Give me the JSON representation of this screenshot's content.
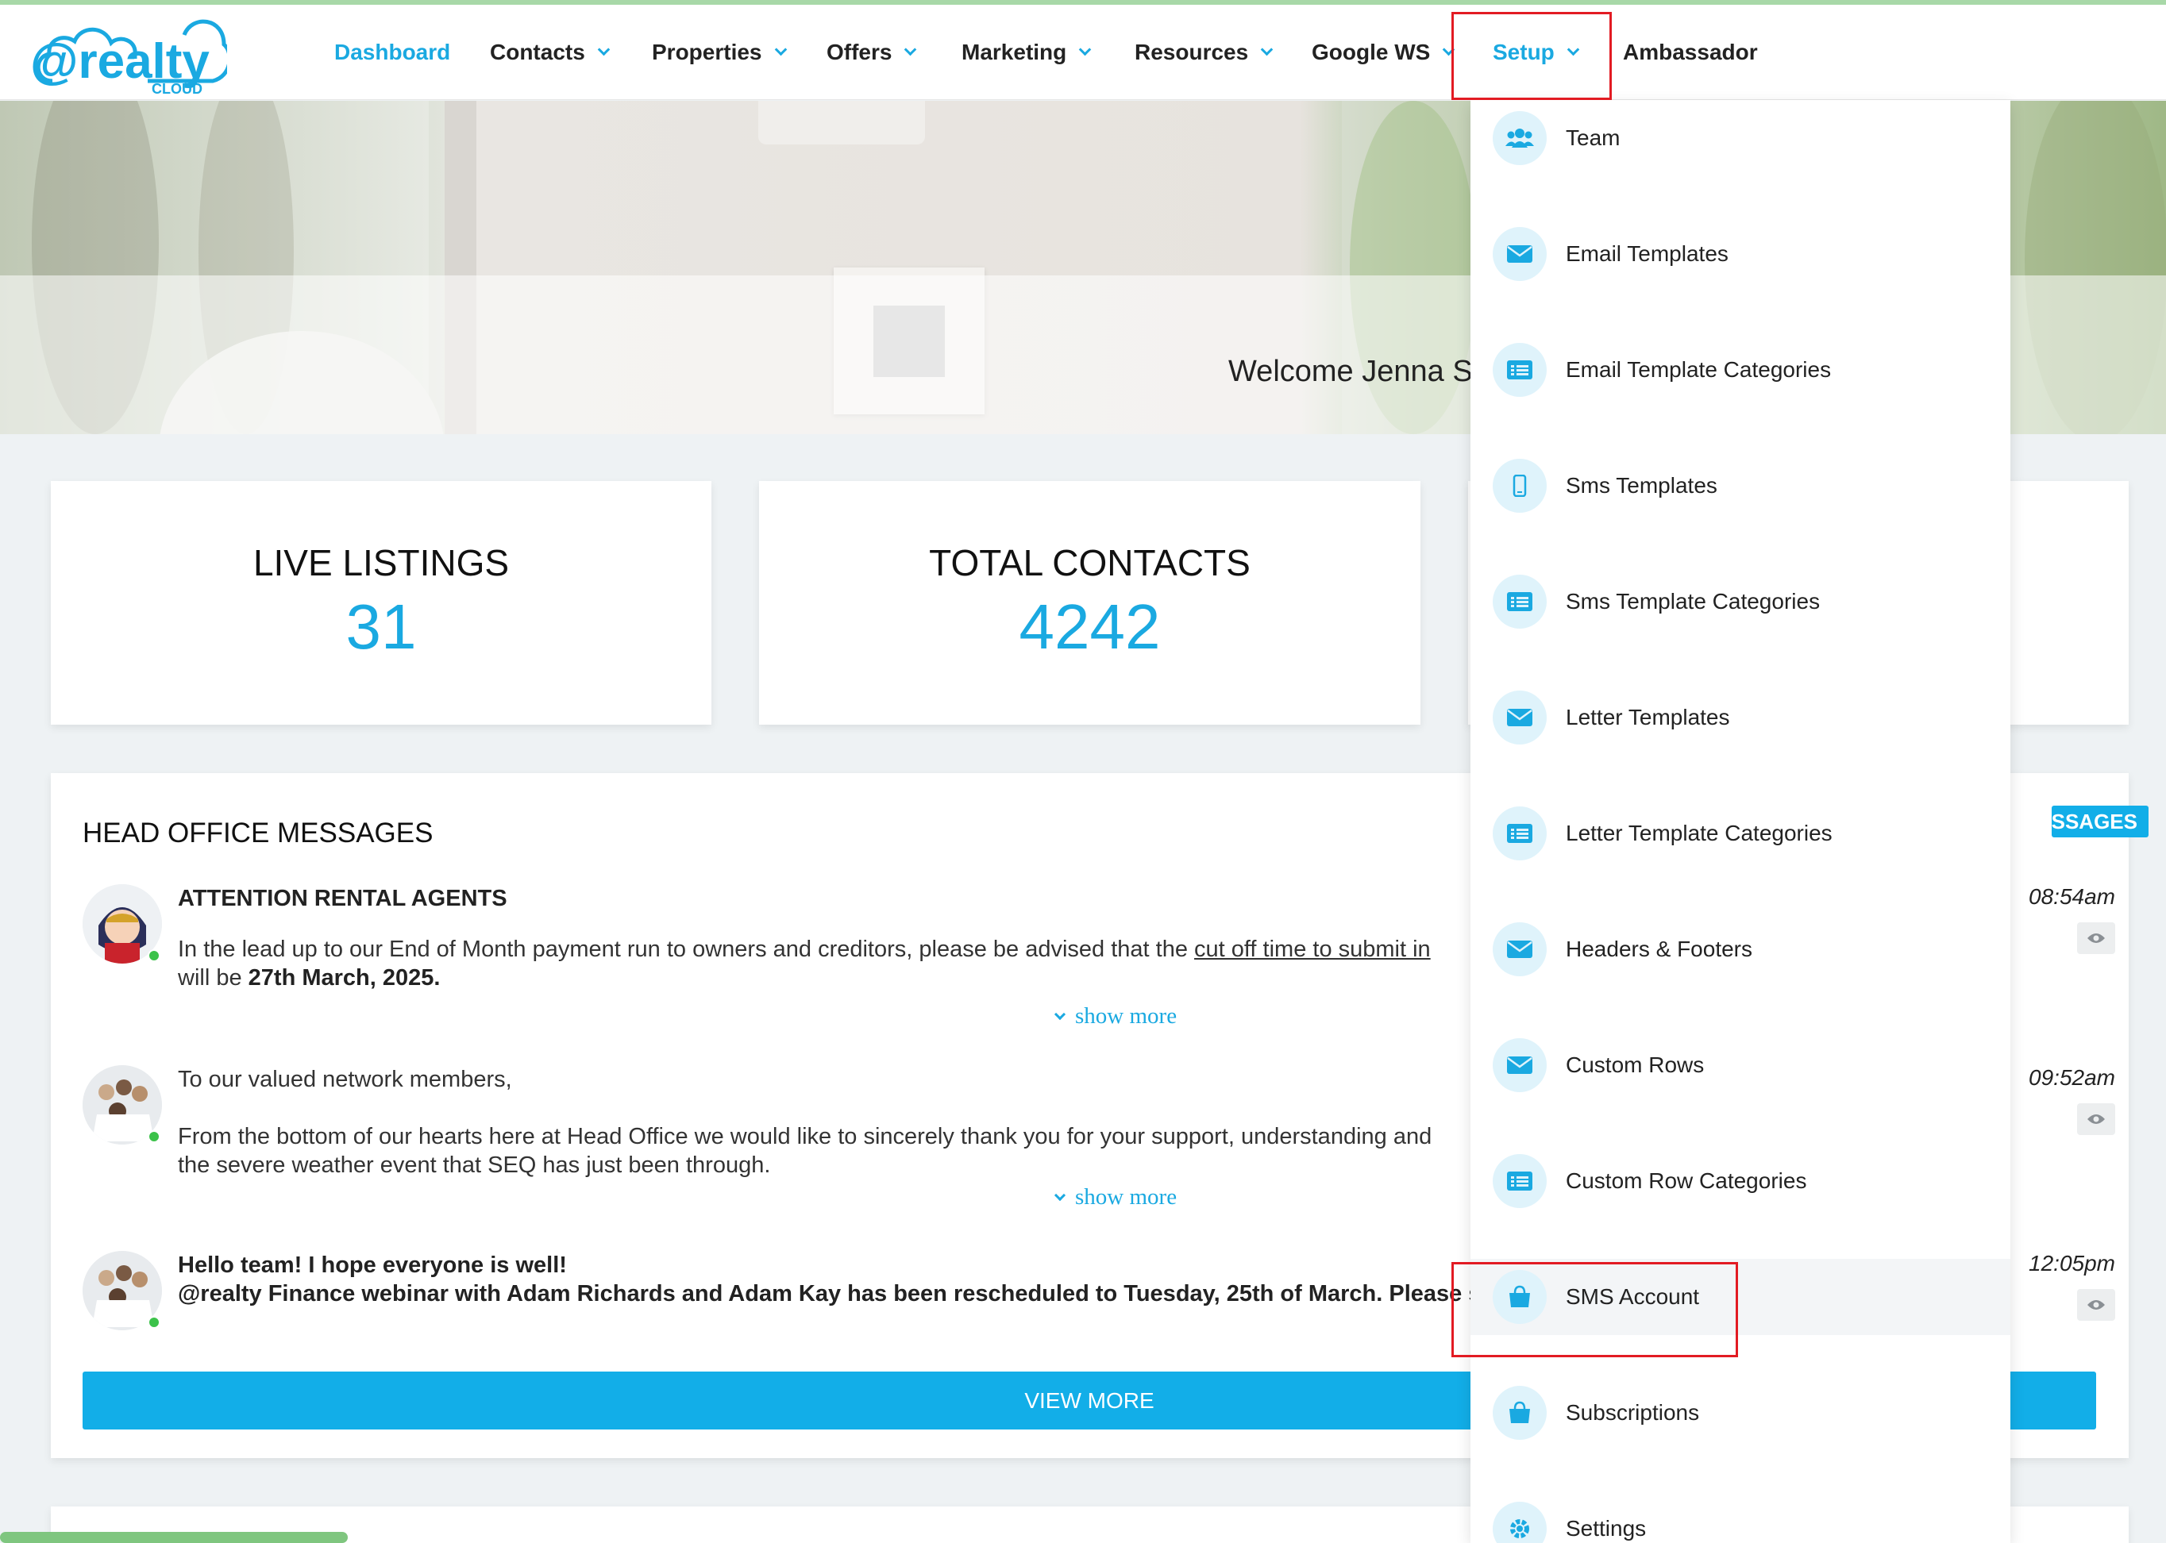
{
  "brand": {
    "logo_main": "@realty",
    "logo_sub": "CLOUD"
  },
  "colors": {
    "accent": "#1aa9e1",
    "highlight_box": "#e21b23",
    "button": "#12aee8"
  },
  "nav": {
    "items": [
      {
        "label": "Dashboard",
        "active": true,
        "has_caret": false
      },
      {
        "label": "Contacts",
        "has_caret": true
      },
      {
        "label": "Properties",
        "has_caret": true
      },
      {
        "label": "Offers",
        "has_caret": true
      },
      {
        "label": "Marketing",
        "has_caret": true
      },
      {
        "label": "Resources",
        "has_caret": true
      },
      {
        "label": "Google WS",
        "has_caret": true
      },
      {
        "label": "Setup",
        "active": true,
        "has_caret": true
      },
      {
        "label": "Ambassador",
        "has_caret": false
      }
    ]
  },
  "hero": {
    "welcome": "Welcome Jenna S"
  },
  "stats": {
    "live_listings": {
      "label": "LIVE LISTINGS",
      "value": "31"
    },
    "total_contacts": {
      "label": "TOTAL CONTACTS",
      "value": "4242"
    }
  },
  "messages": {
    "title": "HEAD OFFICE MESSAGES",
    "all_button": "SSAGES",
    "view_more": "VIEW MORE",
    "show_more": "show more",
    "items": [
      {
        "heading": "ATTENTION RENTAL AGENTS",
        "line1_pre": "In the lead up to our End of Month payment run to owners and creditors, please be advised that the ",
        "line1_link": "cut off time to submit in",
        "line2_pre": "will be ",
        "line2_bold": "27th March, 2025.",
        "time": "08:54am"
      },
      {
        "line1": "To our valued network members,",
        "line2": "From the bottom of our hearts here at Head Office we would like to sincerely thank you for your support, understanding and",
        "line3": "the severe weather event that SEQ has just been through.",
        "time": "09:52am"
      },
      {
        "line1": "Hello team! I hope everyone is well!",
        "line2": "@realty Finance webinar with Adam Richards and Adam Kay has been rescheduled to Tuesday, 25th of March. Please star",
        "time": "12:05pm"
      }
    ]
  },
  "setup_menu": {
    "items": [
      {
        "label": "Team",
        "icon": "team-icon"
      },
      {
        "label": "Email Templates",
        "icon": "envelope-icon"
      },
      {
        "label": "Email Template Categories",
        "icon": "list-icon"
      },
      {
        "label": "Sms Templates",
        "icon": "mobile-icon"
      },
      {
        "label": "Sms Template Categories",
        "icon": "list-icon"
      },
      {
        "label": "Letter Templates",
        "icon": "envelope-icon"
      },
      {
        "label": "Letter Template Categories",
        "icon": "list-icon"
      },
      {
        "label": "Headers & Footers",
        "icon": "envelope-icon"
      },
      {
        "label": "Custom Rows",
        "icon": "envelope-icon"
      },
      {
        "label": "Custom Row Categories",
        "icon": "list-icon"
      },
      {
        "label": "SMS Account",
        "icon": "shopping-bag-icon",
        "highlighted": true
      },
      {
        "label": "Subscriptions",
        "icon": "shopping-bag-icon"
      },
      {
        "label": "Settings",
        "icon": "gear-icon"
      }
    ]
  }
}
